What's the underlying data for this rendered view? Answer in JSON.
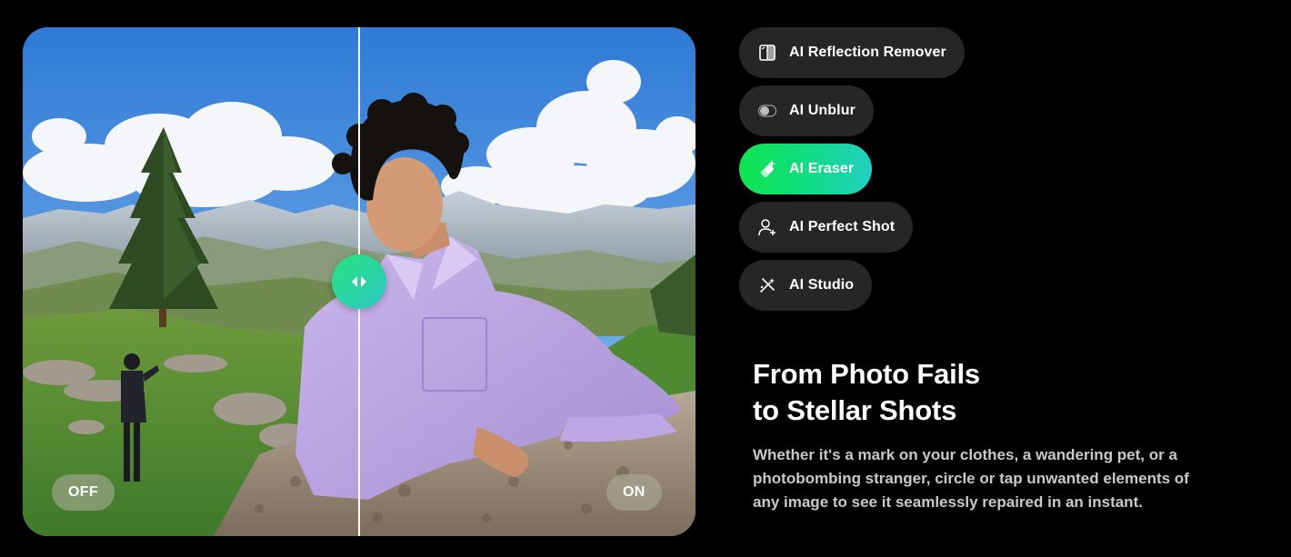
{
  "comparison": {
    "label_off": "OFF",
    "label_on": "ON",
    "handle_icon": "left-right-arrows-icon"
  },
  "features": [
    {
      "label": "AI Reflection Remover",
      "icon": "reflection-icon",
      "active": false
    },
    {
      "label": "AI Unblur",
      "icon": "toggle-blur-icon",
      "active": false
    },
    {
      "label": "AI Eraser",
      "icon": "eraser-sparkle-icon",
      "active": true
    },
    {
      "label": "AI Perfect Shot",
      "icon": "person-plus-icon",
      "active": false
    },
    {
      "label": "AI Studio",
      "icon": "studio-wand-icon",
      "active": false
    }
  ],
  "content": {
    "headline_line1": "From Photo Fails",
    "headline_line2": "to Stellar Shots",
    "description": "Whether it's a mark on your clothes, a wandering pet, or a photobombing stranger, circle or tap unwanted elements of any image to see it seamlessly repaired in an instant."
  },
  "colors": {
    "background": "#000000",
    "button_bg": "#262626",
    "accent_green": "#0ee54e",
    "accent_teal": "#22cfc4",
    "body_text": "#c9c9c9"
  }
}
